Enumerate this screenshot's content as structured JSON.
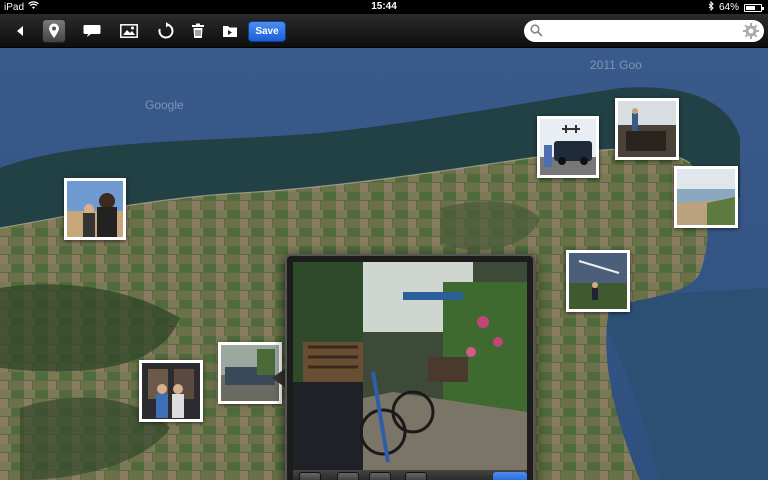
{
  "status_bar": {
    "device": "iPad",
    "time": "15:44",
    "battery": "64%"
  },
  "toolbar": {
    "save_label": "Save",
    "icons": [
      "back-arrow-icon",
      "location-pin-icon",
      "speech-bubble-icon",
      "photo-icon",
      "rotate-icon",
      "trash-icon",
      "folder-icon"
    ],
    "selected": "location-pin-icon"
  },
  "search": {
    "value": "",
    "placeholder": ""
  },
  "map": {
    "labels": [
      "Google",
      "2011 Goo"
    ]
  },
  "colors": {
    "accent": "#2266dd",
    "sea": "#2a4a7a",
    "land": "#5a6a42"
  }
}
